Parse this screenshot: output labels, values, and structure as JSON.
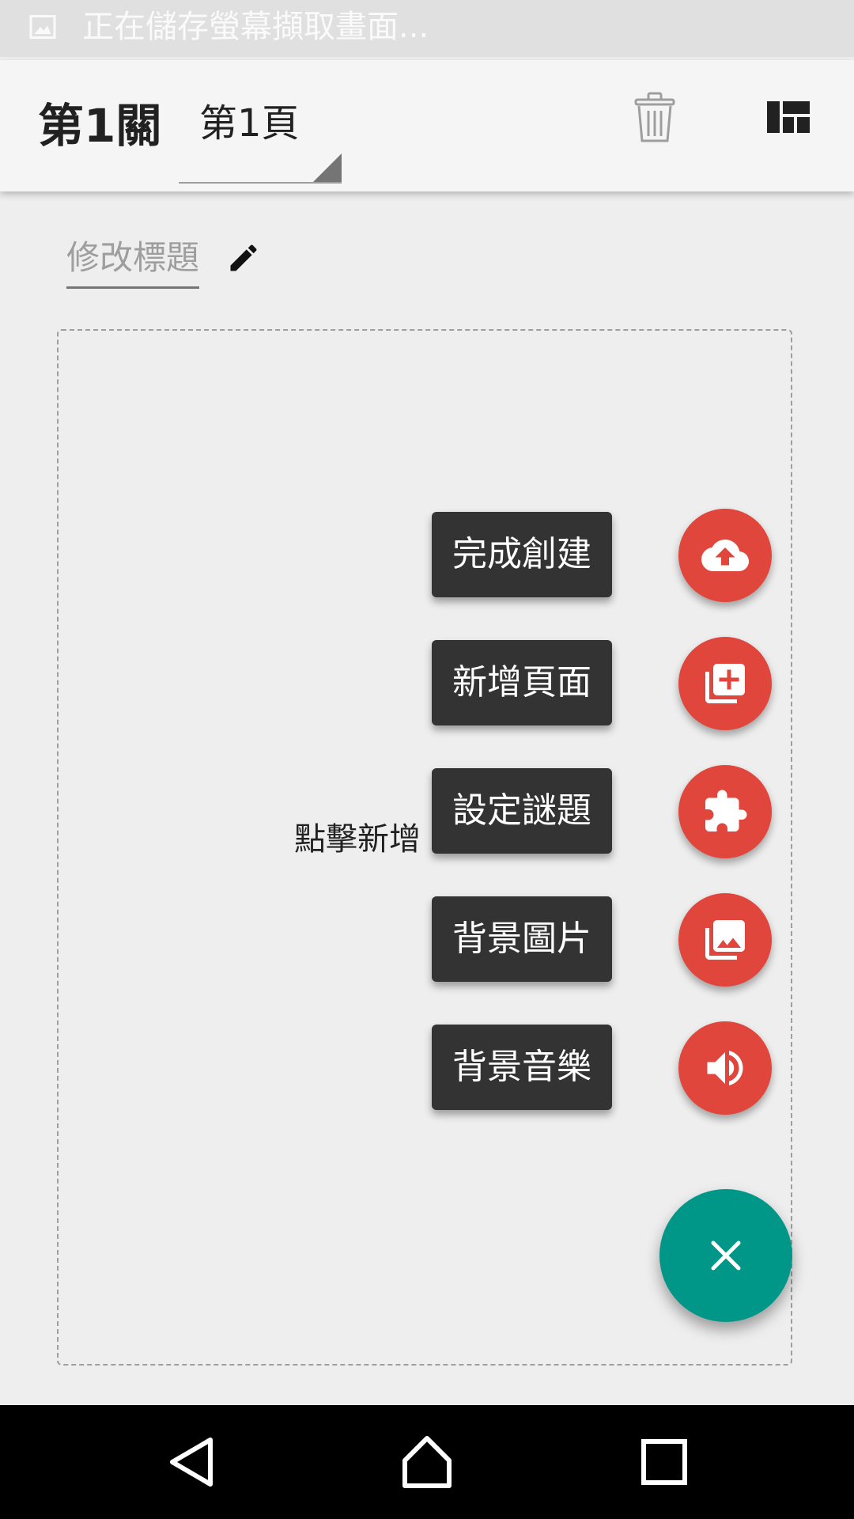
{
  "status_bar": {
    "notification_text": "正在儲存螢幕擷取畫面...",
    "icon": "image-icon"
  },
  "toolbar": {
    "level_title": "第1關",
    "page_selector_value": "第1頁",
    "delete_icon": "trash-icon",
    "layout_icon": "dashboard-layout-icon"
  },
  "editor": {
    "title_placeholder": "修改標題",
    "edit_icon": "pencil-icon",
    "hint_text": "點擊新增"
  },
  "fab_menu": {
    "items": [
      {
        "label": "完成創建",
        "icon": "cloud-upload-icon"
      },
      {
        "label": "新增頁面",
        "icon": "add-page-icon"
      },
      {
        "label": "設定謎題",
        "icon": "puzzle-icon"
      },
      {
        "label": "背景圖片",
        "icon": "photo-library-icon"
      },
      {
        "label": "背景音樂",
        "icon": "volume-icon"
      }
    ],
    "close_icon": "close-icon"
  },
  "colors": {
    "accent_red": "#e0463b",
    "fab_teal": "#009688",
    "label_bg": "#333333"
  },
  "nav_bar": {
    "back_icon": "back-triangle-icon",
    "home_icon": "home-icon",
    "recents_icon": "recents-square-icon"
  }
}
